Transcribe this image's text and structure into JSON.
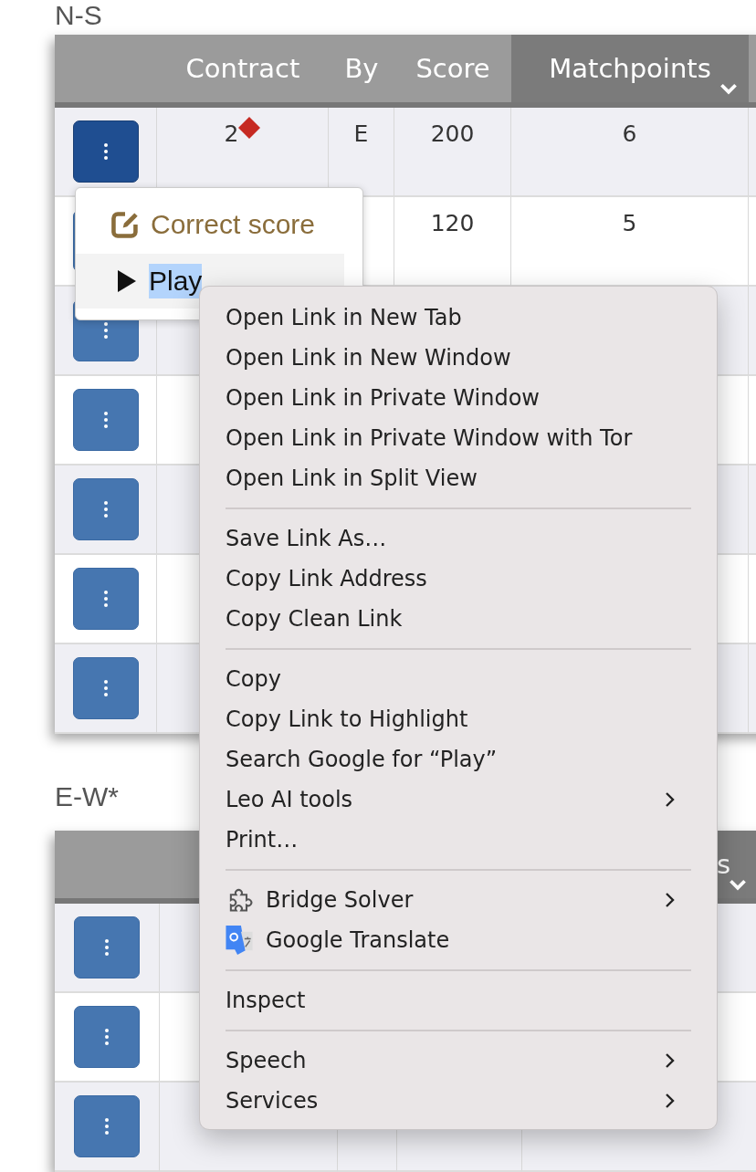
{
  "sections": [
    {
      "title": "N-S",
      "columns": [
        {
          "sorted": false
        },
        {
          "label": "Contract",
          "sorted": false
        },
        {
          "label": "By",
          "sorted": false
        },
        {
          "label": "Score",
          "sorted": false
        },
        {
          "label": "Matchpoints",
          "sorted": true
        }
      ],
      "rows": [
        {
          "active": true,
          "contract": {
            "bid": "2",
            "kind": "diamond"
          },
          "by": "E",
          "score": "200",
          "matchpoints": "6"
        },
        {
          "active": false,
          "score": "120",
          "matchpoints": "5"
        },
        {
          "active": false
        },
        {
          "active": false
        },
        {
          "active": false
        },
        {
          "active": false
        },
        {
          "active": false
        }
      ]
    },
    {
      "title": "E-W*",
      "columns": [
        {
          "sorted": false
        },
        {
          "sorted": false
        },
        {},
        {},
        {
          "label": "s",
          "sorted": true
        }
      ],
      "rows": [
        {
          "active": false
        },
        {
          "active": false
        },
        {
          "active": false
        }
      ]
    }
  ],
  "row_menu": {
    "items": [
      {
        "label": "Correct score",
        "kind": "edit",
        "hovered": false,
        "text_selected": false
      },
      {
        "label": "Play",
        "kind": "play",
        "hovered": true,
        "text_selected": true
      }
    ]
  },
  "context_menu": {
    "groups": [
      [
        {
          "label": "Open Link in New Tab",
          "kind": "text",
          "submenu": false
        },
        {
          "label": "Open Link in New Window",
          "kind": "text",
          "submenu": false
        },
        {
          "label": "Open Link in Private Window",
          "kind": "text",
          "submenu": false
        },
        {
          "label": "Open Link in Private Window with Tor",
          "kind": "text",
          "submenu": false
        },
        {
          "label": "Open Link in Split View",
          "kind": "text",
          "submenu": false
        }
      ],
      [
        {
          "label": "Save Link As…",
          "kind": "text",
          "submenu": false
        },
        {
          "label": "Copy Link Address",
          "kind": "text",
          "submenu": false
        },
        {
          "label": "Copy Clean Link",
          "kind": "text",
          "submenu": false
        }
      ],
      [
        {
          "label": "Copy",
          "kind": "text",
          "submenu": false
        },
        {
          "label": "Copy Link to Highlight",
          "kind": "text",
          "submenu": false
        },
        {
          "label": "Search Google for “Play”",
          "kind": "text",
          "submenu": false
        },
        {
          "label": "Leo AI tools",
          "kind": "text",
          "submenu": true
        },
        {
          "label": "Print…",
          "kind": "text",
          "submenu": false
        }
      ],
      [
        {
          "label": "Bridge Solver",
          "kind": "extension",
          "submenu": true
        },
        {
          "label": "Google Translate",
          "kind": "translate",
          "submenu": false
        }
      ],
      [
        {
          "label": "Inspect",
          "kind": "text",
          "submenu": false
        }
      ],
      [
        {
          "label": "Speech",
          "kind": "text",
          "submenu": true
        },
        {
          "label": "Services",
          "kind": "text",
          "submenu": true
        }
      ]
    ]
  }
}
